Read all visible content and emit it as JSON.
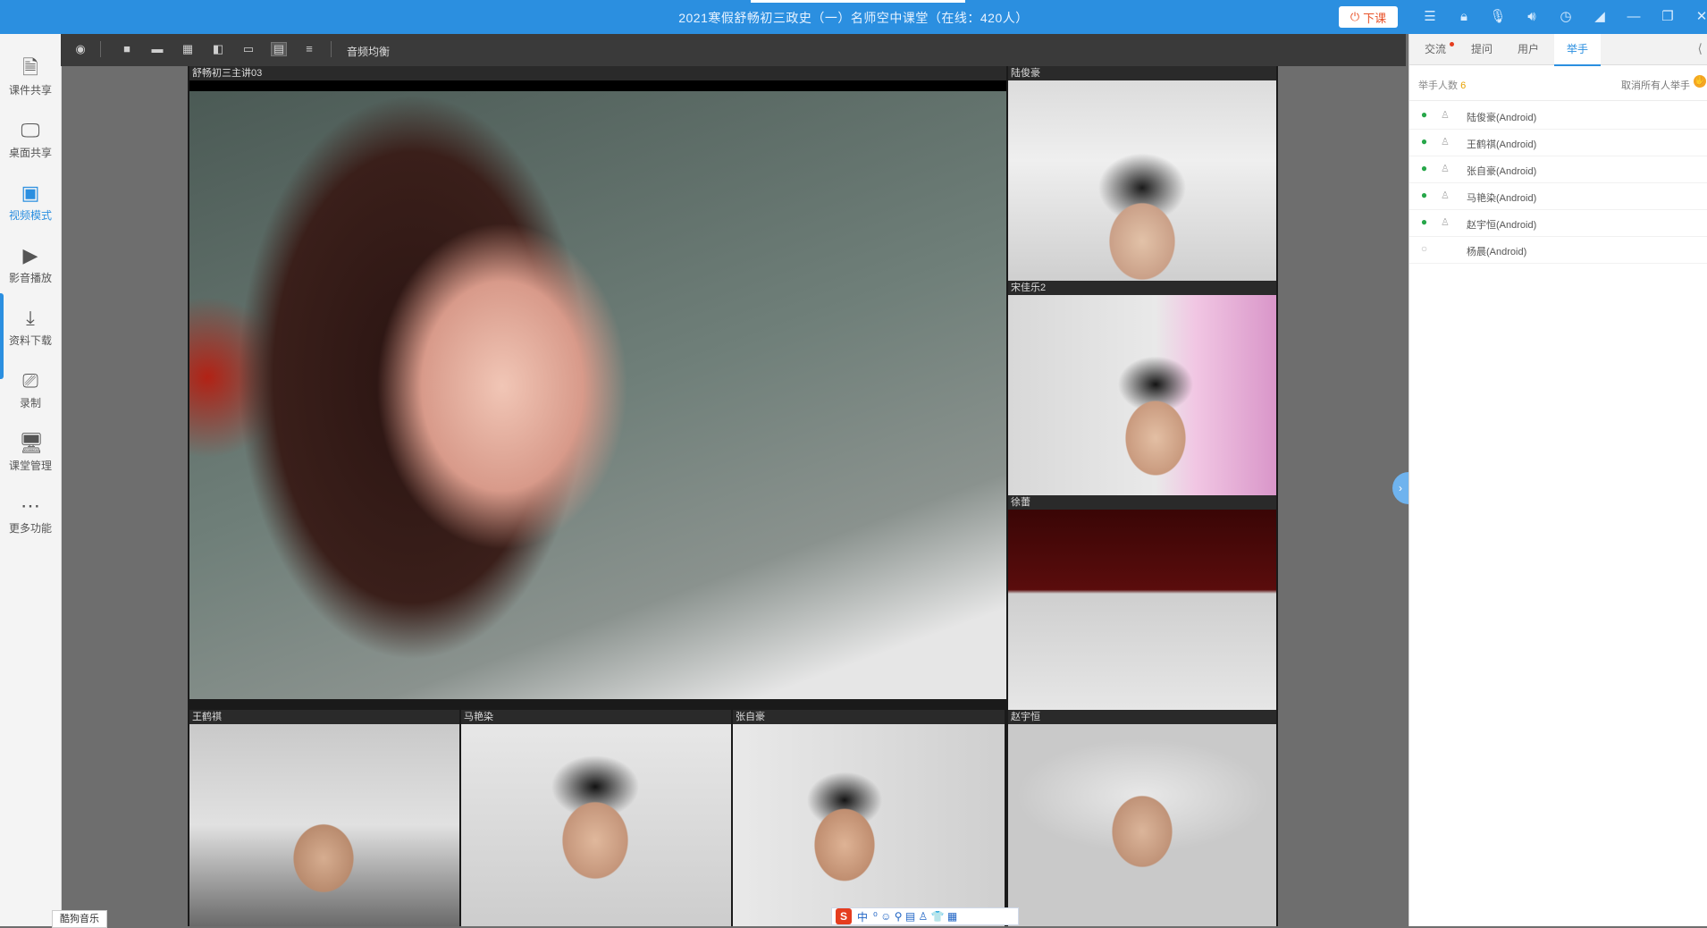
{
  "window": {
    "title": "2021寒假舒畅初三政史（一）名师空中课堂（在线：420人）",
    "exit_label": "下课",
    "icons": [
      "menu-icon",
      "lock-icon",
      "mic-icon",
      "speaker-icon",
      "clock-icon",
      "signal-icon",
      "minimize-icon",
      "restore-icon",
      "close-icon"
    ]
  },
  "sidebar": {
    "items": [
      {
        "label": "课件共享",
        "icon": "document-icon"
      },
      {
        "label": "桌面共享",
        "icon": "screen-share-icon"
      },
      {
        "label": "视频模式",
        "icon": "video-mode-icon",
        "active": true
      },
      {
        "label": "影音播放",
        "icon": "play-icon"
      },
      {
        "label": "资料下载",
        "icon": "download-icon"
      },
      {
        "label": "录制",
        "icon": "record-icon"
      },
      {
        "label": "课堂管理",
        "icon": "classroom-icon"
      },
      {
        "label": "更多功能",
        "icon": "more-icon"
      }
    ],
    "music_label": "酷狗音乐"
  },
  "toolbar": {
    "audio_label": "音频均衡"
  },
  "videos": [
    {
      "name": "舒畅初三主讲03"
    },
    {
      "name": "陆俊豪"
    },
    {
      "name": "宋佳乐2"
    },
    {
      "name": "徐蕾"
    },
    {
      "name": "王鹤祺"
    },
    {
      "name": "马艳染"
    },
    {
      "name": "张自豪"
    },
    {
      "name": "赵宇恒"
    }
  ],
  "ime": {
    "logo": "S",
    "lang": "中",
    "icons": "⁰ ☺ ⚲ ▤ ♙ 👕 ▦"
  },
  "panel": {
    "tabs": [
      {
        "label": "交流",
        "badge": true
      },
      {
        "label": "提问"
      },
      {
        "label": "用户"
      },
      {
        "label": "举手",
        "active": true
      }
    ],
    "hand_count_label": "举手人数",
    "hand_count": "6",
    "cancel_all_label": "取消所有人举手",
    "raised": [
      {
        "name": "陆俊豪(Android)",
        "active": true
      },
      {
        "name": "王鹤祺(Android)",
        "active": true
      },
      {
        "name": "张自豪(Android)",
        "active": true
      },
      {
        "name": "马艳染(Android)",
        "active": true
      },
      {
        "name": "赵宇恒(Android)",
        "active": true
      },
      {
        "name": "杨晨(Android)",
        "active": false
      }
    ]
  }
}
